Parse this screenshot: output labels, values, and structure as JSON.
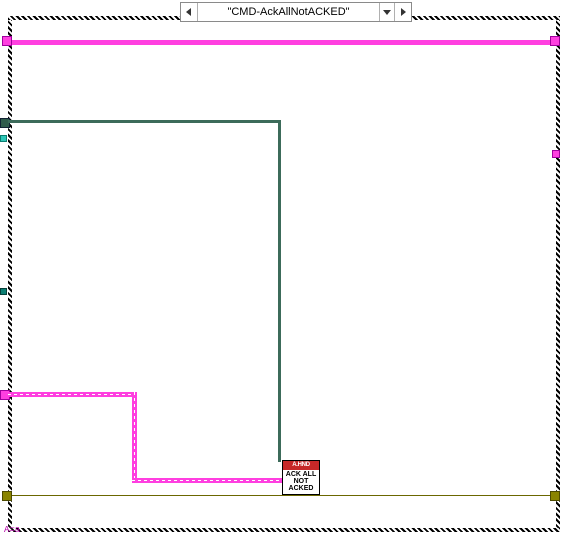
{
  "selector": {
    "case_label": "\"CMD-AckAllNotACKED\""
  },
  "node": {
    "header": "A.HND",
    "line1": "ACK ALL",
    "line2": "NOT",
    "line3": "ACKED"
  },
  "corner": "A=a",
  "chart_data": {
    "type": "diagram",
    "tool": "LabVIEW block diagram",
    "structure": "Case Structure",
    "selected_case": "CMD-AckAllNotACKED",
    "nodes": [
      {
        "id": "ack_all_not_acked_vi",
        "header": "A.HND",
        "label": "ACK ALL NOT ACKED"
      }
    ],
    "wires": [
      {
        "color": "pink",
        "style": "thick",
        "from": "left-tunnel-top",
        "to": "right-tunnel-top"
      },
      {
        "color": "olive",
        "style": "thin",
        "from": "left-tunnel-bottom",
        "to": "right-tunnel-bottom"
      },
      {
        "color": "dark-green",
        "style": "solid",
        "path": [
          "left-mid-tunnel",
          "right",
          "down",
          "into-node-top-right"
        ]
      },
      {
        "color": "pink-cluster",
        "style": "dashed-core",
        "path": [
          "left-lower-tunnel",
          "right",
          "down",
          "right",
          "into-node-left"
        ]
      }
    ]
  }
}
